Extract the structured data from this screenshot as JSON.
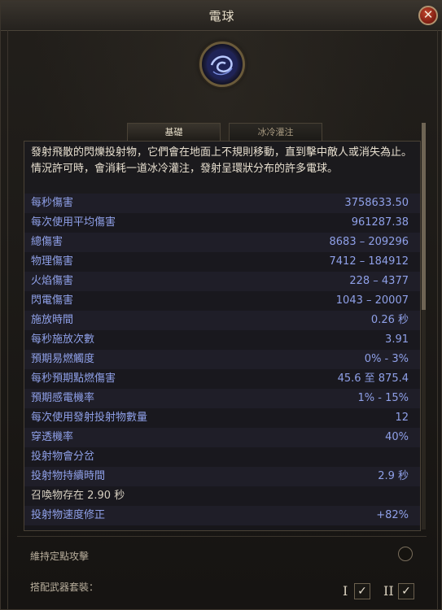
{
  "window": {
    "title": "電球"
  },
  "close_icon_glyph": "✕",
  "tabs": [
    {
      "label": "基礎"
    },
    {
      "label": "冰冷灌注"
    }
  ],
  "description": "發射飛散的閃爍投射物，它們會在地面上不規則移動，直到擊中敵人或消失為止。情況許可時，會消耗一道冰冷灌注，發射呈環狀分布的許多電球。",
  "stats": [
    {
      "label": "每秒傷害",
      "value": "3758633.50"
    },
    {
      "label": "每次使用平均傷害",
      "value": "961287.38"
    },
    {
      "label": "總傷害",
      "value": "8683 – 209296"
    },
    {
      "label": "物理傷害",
      "value": "7412 – 184912"
    },
    {
      "label": "火焰傷害",
      "value": "228 – 4377"
    },
    {
      "label": "閃電傷害",
      "value": "1043 – 20007"
    },
    {
      "label": "施放時間",
      "value": "0.26 秒"
    },
    {
      "label": "每秒施放次數",
      "value": "3.91"
    },
    {
      "label": "預期易燃觸度",
      "value": "0% - 3%"
    },
    {
      "label": "每秒預期點燃傷害",
      "value": "45.6 至 875.4"
    },
    {
      "label": "預期感電機率",
      "value": "1% - 15%"
    },
    {
      "label": "每次使用發射投射物數量",
      "value": "12"
    },
    {
      "label": "穿透機率",
      "value": "40%"
    },
    {
      "label": "投射物會分岔",
      "value": ""
    },
    {
      "label": "投射物持續時間",
      "value": "2.9 秒"
    },
    {
      "label": "召喚物存在 2.90 秒",
      "value": ""
    },
    {
      "label": "投射物速度修正",
      "value": "+82%"
    }
  ],
  "options": {
    "hold_position_label": "維持定點攻擊",
    "weapon_set_label": "搭配武器套裝：",
    "weapon_set_1": "I",
    "weapon_set_2": "II",
    "check_glyph": "✓"
  },
  "scroll_fraction": 0.46
}
